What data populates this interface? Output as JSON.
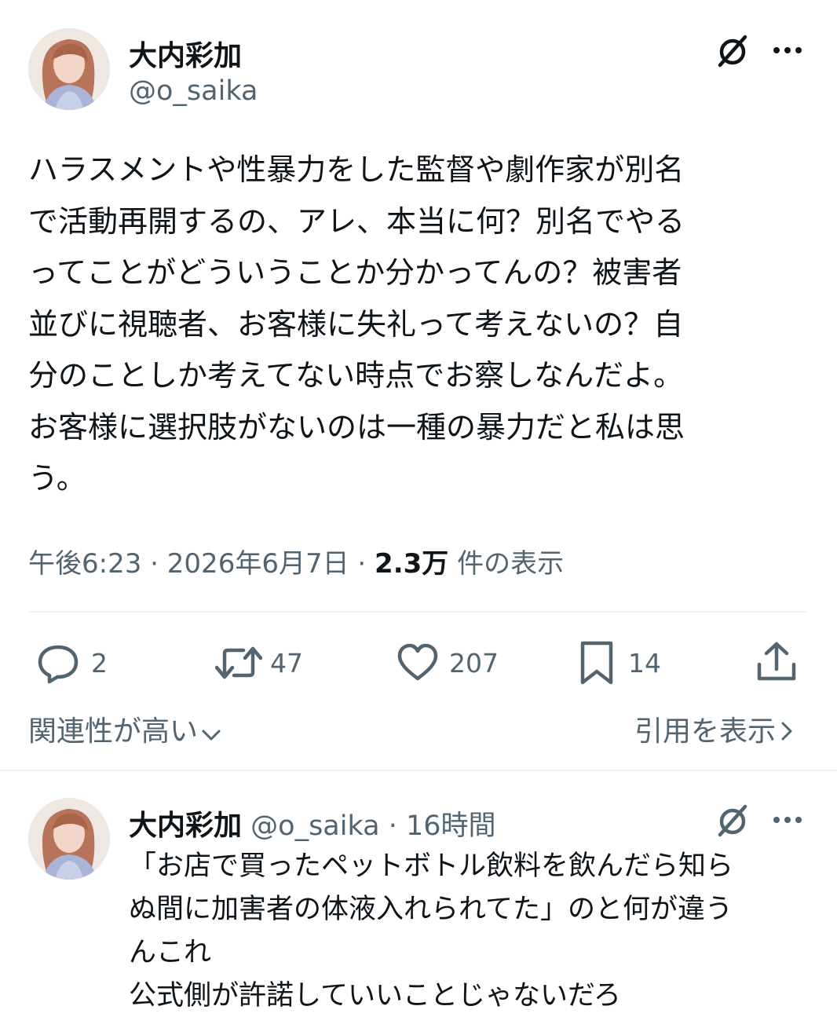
{
  "main_post": {
    "author_name": "大内彩加",
    "author_handle": "@o_saika",
    "text": "ハラスメントや性暴力をした監督や劇作家が別名\nで活動再開するの、アレ、本当に何？別名でやる\nってことがどういうことか分かってんの？被害者\n並びに視聴者、お客様に失礼って考えないの？自\n分のことしか考えてない時点でお察しなんだよ。\nお客様に選択肢がないのは一種の暴力だと私は思\nう。",
    "time": "午後6:23",
    "separator": "·",
    "date": "2026年6月7日",
    "views_count": "2.3万",
    "views_label": "件の表示",
    "actions": {
      "reply_count": "2",
      "repost_count": "47",
      "like_count": "207",
      "bookmark_count": "14"
    },
    "sort_label": "関連性が高い",
    "quotes_label": "引用を表示"
  },
  "reply_post": {
    "author_name": "大内彩加",
    "author_handle": "@o_saika",
    "separator": "·",
    "time_ago": "16時間",
    "text": "「お店で買ったペットボトル飲料を飲んだら知ら\nぬ間に加害者の体液入れられてた」のと何が違う\nんこれ\n公式側が許諾していいことじゃないだろ"
  },
  "icons": {
    "grok": "slashed-circle-icon",
    "more": "more-dots-icon",
    "reply": "speech-bubble-icon",
    "repost": "repost-arrows-icon",
    "like": "heart-icon",
    "bookmark": "bookmark-icon",
    "share": "share-upload-icon",
    "chevron_down": "chevron-down-icon",
    "chevron_right": "chevron-right-icon"
  },
  "colors": {
    "text": "#0f1419",
    "secondary": "#536471",
    "divider": "#eff3f4"
  }
}
